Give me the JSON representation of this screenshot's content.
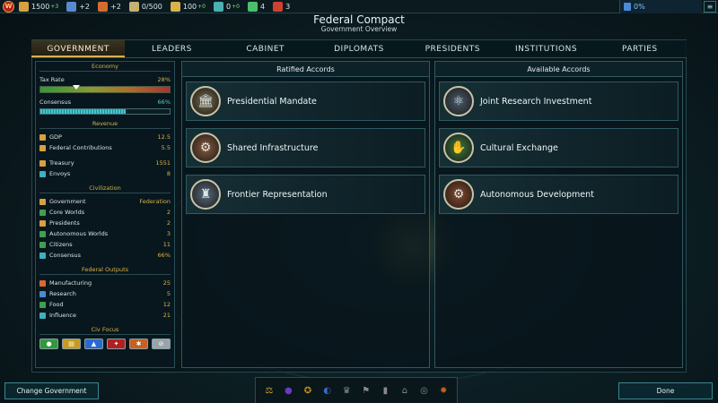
{
  "topbar": {
    "logo_letter": "W",
    "resources": [
      {
        "name": "credits",
        "value": "1500",
        "delta": "+3",
        "icon": "coins-icon",
        "color": "#d8a040"
      },
      {
        "name": "manufacturing",
        "value": "+2",
        "delta": "",
        "icon": "hammer-icon",
        "color": "#5a8ad0"
      },
      {
        "name": "research",
        "value": "+2",
        "delta": "",
        "icon": "flask-icon",
        "color": "#d86a30"
      },
      {
        "name": "storage",
        "value": "0/500",
        "delta": "",
        "icon": "crate-icon",
        "color": "#c8b070"
      },
      {
        "name": "influence",
        "value": "100",
        "delta": "+0",
        "icon": "sun-icon",
        "color": "#d9b24a"
      },
      {
        "name": "population",
        "value": "0",
        "delta": "+0",
        "icon": "city-icon",
        "color": "#4ab0b0"
      },
      {
        "name": "ships",
        "value": "4",
        "delta": "",
        "icon": "ship-icon",
        "color": "#4ac06a"
      },
      {
        "name": "threat",
        "value": "3",
        "delta": "",
        "icon": "threat-icon",
        "color": "#d04030"
      }
    ],
    "progress_label": "0%",
    "menu_icon": "≡"
  },
  "header": {
    "title": "Federal Compact",
    "subtitle": "Government Overview"
  },
  "tabs": [
    "GOVERNMENT",
    "LEADERS",
    "CABINET",
    "DIPLOMATS",
    "PRESIDENTS",
    "INSTITUTIONS",
    "PARTIES"
  ],
  "left": {
    "economy": {
      "header": "Economy",
      "tax_label": "Tax Rate",
      "tax_value": "28%",
      "tax_fraction": 0.28,
      "consensus_label": "Consensus",
      "consensus_value": "66%",
      "consensus_fraction": 0.66
    },
    "revenue": {
      "header": "Revenue",
      "rows": [
        {
          "label": "GDP",
          "value": "12.5",
          "icon": "coins-icon",
          "color": "#d8a040"
        },
        {
          "label": "Federal Contributions",
          "value": "5.5",
          "icon": "stack-icon",
          "color": "#d8a040"
        },
        {
          "label": "Treasury",
          "value": "1551",
          "icon": "treasury-icon",
          "color": "#d8a040"
        },
        {
          "label": "Envoys",
          "value": "8",
          "icon": "envoy-icon",
          "color": "#40b0c0"
        }
      ]
    },
    "civilization": {
      "header": "Civilization",
      "rows": [
        {
          "label": "Government",
          "value": "Federation",
          "icon": "government-icon",
          "color": "#d8a040"
        },
        {
          "label": "Core Worlds",
          "value": "2",
          "icon": "planet-icon",
          "color": "#40a050"
        },
        {
          "label": "Presidents",
          "value": "2",
          "icon": "person-icon",
          "color": "#d8a040"
        },
        {
          "label": "Autonomous Worlds",
          "value": "3",
          "icon": "planet-icon",
          "color": "#40a050"
        },
        {
          "label": "Citizens",
          "value": "11",
          "icon": "citizen-icon",
          "color": "#40a050"
        },
        {
          "label": "Consensus",
          "value": "66%",
          "icon": "consensus-icon",
          "color": "#40b0c0"
        }
      ]
    },
    "outputs": {
      "header": "Federal Outputs",
      "rows": [
        {
          "label": "Manufacturing",
          "value": "25",
          "icon": "hammer-icon",
          "color": "#d86a30"
        },
        {
          "label": "Research",
          "value": "5",
          "icon": "flask-icon",
          "color": "#4a8ad8"
        },
        {
          "label": "Food",
          "value": "12",
          "icon": "food-icon",
          "color": "#40a050"
        },
        {
          "label": "Influence",
          "value": "21",
          "icon": "influence-icon",
          "color": "#40b0c0"
        }
      ]
    },
    "focus": {
      "header": "Civ Focus",
      "buttons": [
        {
          "icon": "citizen-icon",
          "color": "#2f9a3a",
          "glyph": "●"
        },
        {
          "icon": "stack-icon",
          "color": "#c89a20",
          "glyph": "▤"
        },
        {
          "icon": "flask-icon",
          "color": "#2a6ad0",
          "glyph": "▲"
        },
        {
          "icon": "threat-icon",
          "color": "#b02020",
          "glyph": "✦"
        },
        {
          "icon": "gear-icon",
          "color": "#c86020",
          "glyph": "✱"
        },
        {
          "icon": "none-icon",
          "color": "#9aa4a8",
          "glyph": "⊘"
        }
      ]
    }
  },
  "ratified": {
    "header": "Ratified Accords",
    "items": [
      {
        "name": "Presidential Mandate",
        "icon": "temple-icon",
        "color": "#7a6a4a",
        "glyph": "🏛"
      },
      {
        "name": "Shared Infrastructure",
        "icon": "factory-gear-icon",
        "color": "#8a5a3a",
        "glyph": "⚙"
      },
      {
        "name": "Frontier Representation",
        "icon": "assembly-icon",
        "color": "#5a6a7a",
        "glyph": "♜"
      }
    ]
  },
  "available": {
    "header": "Available Accords",
    "items": [
      {
        "name": "Joint Research Investment",
        "icon": "research-gear-icon",
        "color": "#4a5a6a",
        "glyph": "⚛"
      },
      {
        "name": "Cultural Exchange",
        "icon": "handshake-icon",
        "color": "#3a7a3a",
        "glyph": "✋"
      },
      {
        "name": "Autonomous Development",
        "icon": "gears-icon",
        "color": "#8a4a2a",
        "glyph": "⚙"
      }
    ]
  },
  "buttons": {
    "change_government": "Change Government",
    "done": "Done"
  },
  "dock": [
    {
      "icon": "scales-icon",
      "color": "#c8a040",
      "glyph": "⚖"
    },
    {
      "icon": "sphere-icon",
      "color": "#6a3ac0",
      "glyph": "●"
    },
    {
      "icon": "medal-icon",
      "color": "#c89020",
      "glyph": "✪"
    },
    {
      "icon": "planet-ring-icon",
      "color": "#3a6ad0",
      "glyph": "◐"
    },
    {
      "icon": "trophy-icon",
      "color": "#8a8a8a",
      "glyph": "♛"
    },
    {
      "icon": "flag-icon",
      "color": "#8a8a8a",
      "glyph": "⚑"
    },
    {
      "icon": "tower-icon",
      "color": "#8a8a8a",
      "glyph": "▮"
    },
    {
      "icon": "dome-icon",
      "color": "#8a8a8a",
      "glyph": "⌂"
    },
    {
      "icon": "ring-icon",
      "color": "#8a8a8a",
      "glyph": "◎"
    },
    {
      "icon": "gear-icon",
      "color": "#c86020",
      "glyph": "✹"
    }
  ]
}
